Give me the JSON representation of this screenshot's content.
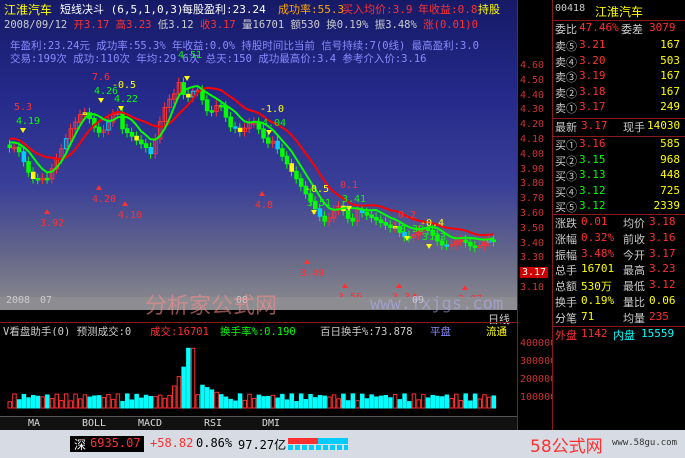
{
  "header": {
    "line1": {
      "stock": "江淮汽车",
      "indicator": "短线决斗 (6,5,1,0,3)",
      "eps": "每股盈利:23.24",
      "winrate": "成功率:55.3",
      "buy_price": "买入均价:3.9",
      "annual": "年收益:0.8",
      "hold": "持股"
    },
    "line2": {
      "date": "2008/09/12",
      "open": "开3.17",
      "high": "高3.23",
      "low": "低3.12",
      "close": "收3.17",
      "vol": "量16701",
      "amount": "额530",
      "turnover": "换0.19%",
      "amplitude": "振3.48%",
      "change": "涨(0.01)0"
    },
    "line3": "年盈利:23.24元  成功率:55.3%  年收益:0.0%  持股时间比当前  信号持续:7(0线)  最高盈利:3.0",
    "line4": "交易:199次  成功:110次  年均:29.6次  总天:150  成功最高价:3.4  参考介入价:3.16",
    "stock_code": "00418"
  },
  "chart_labels": {
    "peaks": [
      {
        "text": "5.3",
        "value": "4.19"
      },
      {
        "text": "7.6",
        "value": "4.26"
      },
      {
        "text": "-0.5",
        "value": "4.22"
      },
      {
        "text": "4.51"
      },
      {
        "text": "-1.0",
        "value": "4.04"
      },
      {
        "text": "-0.5",
        "value": "3.51"
      },
      {
        "text": "0.1",
        "value": "3.41"
      },
      {
        "text": "0.2",
        "value": "3.30"
      },
      {
        "text": "-0.4",
        "value": "3.33"
      }
    ],
    "lows": [
      "3.92",
      "4.20",
      "4.10",
      "4.8",
      "3.49",
      "3.56",
      "3.3",
      "3.31",
      "3.07"
    ],
    "watermark": "分析家公式网",
    "watermark_url": "www.fxjgs.com",
    "dates": [
      "2008",
      "07",
      "08",
      "09"
    ],
    "day_line": "日线"
  },
  "right_axis": [
    "4.60",
    "4.50",
    "4.40",
    "4.30",
    "4.20",
    "4.10",
    "4.00",
    "3.90",
    "3.80",
    "3.70",
    "3.60",
    "3.50",
    "3.40",
    "3.30",
    "3.17",
    "3.10"
  ],
  "vol_axis": [
    "400000",
    "300000",
    "200000",
    "100000"
  ],
  "quote": {
    "title": "江淮汽车",
    "code": "00418",
    "weibi": "委比",
    "weibi_val": "47.46%",
    "weicha": "委差",
    "weicha_val": "3079",
    "asks": [
      {
        "label": "卖⑤",
        "price": "3.21",
        "vol": "167"
      },
      {
        "label": "卖④",
        "price": "3.20",
        "vol": "503"
      },
      {
        "label": "卖③",
        "price": "3.19",
        "vol": "167"
      },
      {
        "label": "卖②",
        "price": "3.18",
        "vol": "167"
      },
      {
        "label": "卖①",
        "price": "3.17",
        "vol": "249"
      }
    ],
    "latest_label": "最新",
    "latest": "3.17",
    "now_label": "现手",
    "now_vol": "14030",
    "bids": [
      {
        "label": "买①",
        "price": "3.16",
        "vol": "585"
      },
      {
        "label": "买②",
        "price": "3.15",
        "vol": "968"
      },
      {
        "label": "买③",
        "price": "3.13",
        "vol": "448"
      },
      {
        "label": "买④",
        "price": "3.12",
        "vol": "725"
      },
      {
        "label": "买⑤",
        "price": "3.12",
        "vol": "2339"
      }
    ],
    "stats": [
      {
        "l1": "涨跌",
        "v1": "0.01",
        "l2": "均价",
        "v2": "3.18"
      },
      {
        "l1": "涨幅",
        "v1": "0.32%",
        "l2": "前收",
        "v2": "3.16"
      },
      {
        "l1": "振幅",
        "v1": "3.48%",
        "l2": "今开",
        "v2": "3.17"
      },
      {
        "l1": "总手",
        "v1": "16701",
        "l2": "最高",
        "v2": "3.23"
      },
      {
        "l1": "总额",
        "v1": "530万",
        "l2": "最低",
        "v2": "3.12"
      },
      {
        "l1": "换手",
        "v1": "0.19%",
        "l2": "量比",
        "v2": "0.06"
      },
      {
        "l1": "分笔",
        "v1": "71",
        "l2": "均量",
        "v2": "235"
      }
    ],
    "outer_label": "外盘",
    "outer": "1142",
    "inner_label": "内盘",
    "inner": "15559"
  },
  "vol_header": {
    "name": "V看盘助手(0) 预测成交:0",
    "vol": "成交:16701",
    "turnover": "换手率%:0.190",
    "hundred": "百日换手%:73.878",
    "lingpan": "平盘",
    "flow": "流通"
  },
  "tabs": [
    "MA",
    "BOLL",
    "MACD",
    "RSI",
    "DMI"
  ],
  "status": {
    "index_name": "深",
    "index_value": "6935.07",
    "change": "+58.82",
    "pct": "0.86%",
    "amount": "97.27亿",
    "site": "58公式网",
    "site_url": "www.58gu.com"
  },
  "colors": {
    "up": "#ff3030",
    "down": "#00ffff",
    "ma_fast": "#00ff00",
    "ma_slow": "#ff0000",
    "yellow": "#ffff00"
  }
}
